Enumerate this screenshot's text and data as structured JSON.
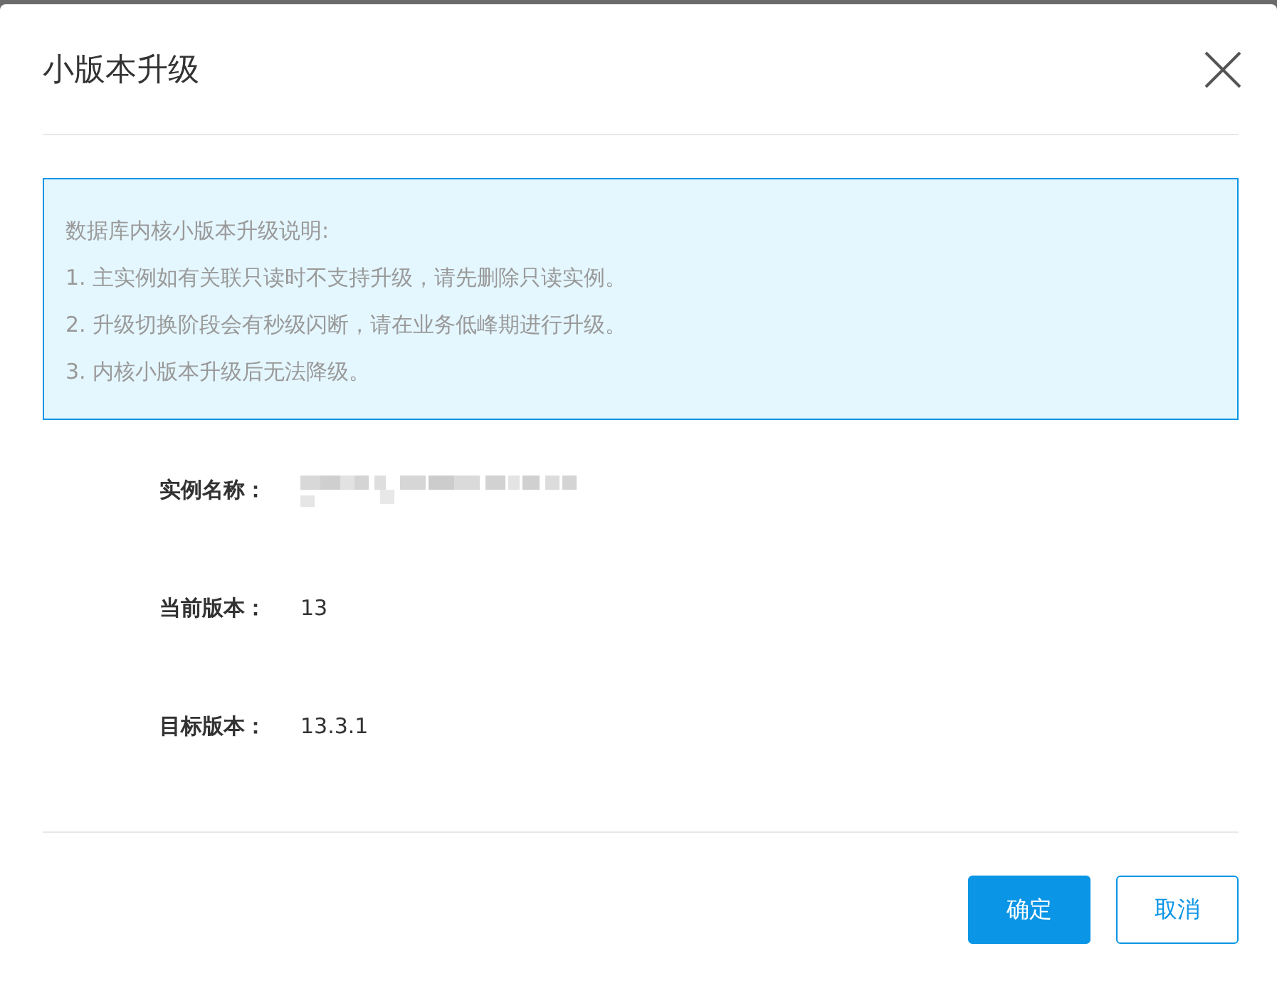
{
  "dialog": {
    "title": "小版本升级"
  },
  "notice": {
    "lines": [
      "数据库内核小版本升级说明:",
      "1. 主实例如有关联只读时不支持升级，请先删除只读实例。",
      "2. 升级切换阶段会有秒级闪断，请在业务低峰期进行升级。",
      "3. 内核小版本升级后无法降级。"
    ]
  },
  "fields": [
    {
      "label": "实例名称：",
      "kind": "redacted"
    },
    {
      "label": "当前版本：",
      "kind": "text",
      "value": "13"
    },
    {
      "label": "目标版本：",
      "kind": "text",
      "value": "13.3.1"
    }
  ],
  "buttons": [
    {
      "label": "确定",
      "kind": "primary"
    },
    {
      "label": "取消",
      "kind": "secondary"
    }
  ]
}
